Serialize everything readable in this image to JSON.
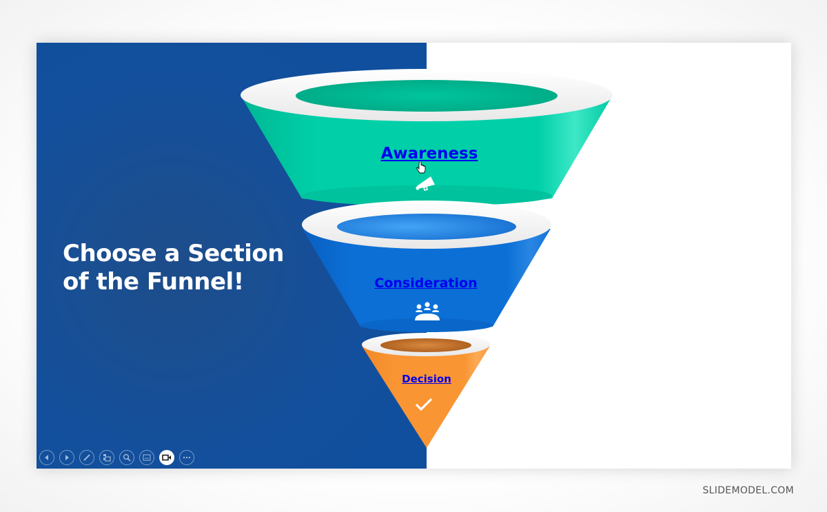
{
  "slide": {
    "headline_lines": [
      "Choose a Section",
      "of the Funnel!"
    ],
    "stages": [
      {
        "label": "Awareness",
        "icon": "megaphone-icon",
        "color": "#00cfa8"
      },
      {
        "label": "Consideration",
        "icon": "meeting-group-icon",
        "color": "#0b6fd6"
      },
      {
        "label": "Decision",
        "icon": "checkmark-icon",
        "color": "#fa9533"
      }
    ],
    "colors": {
      "panel_blue": "#0e4f9e",
      "link_blue": "#0000ee",
      "rim_white": "#ffffff"
    }
  },
  "presenter_toolbar": {
    "buttons": [
      {
        "name": "previous-slide-button",
        "icon": "arrow-left-icon"
      },
      {
        "name": "next-slide-button",
        "icon": "arrow-right-icon"
      },
      {
        "name": "pen-tool-button",
        "icon": "pen-icon"
      },
      {
        "name": "see-all-slides-button",
        "icon": "slides-grid-icon"
      },
      {
        "name": "zoom-button",
        "icon": "magnifier-icon"
      },
      {
        "name": "subtitles-button",
        "icon": "subtitles-icon"
      },
      {
        "name": "camera-button",
        "icon": "video-camera-icon",
        "active": true
      },
      {
        "name": "more-options-button",
        "icon": "more-dots-icon"
      }
    ]
  },
  "watermark": "SLIDEMODEL.COM"
}
